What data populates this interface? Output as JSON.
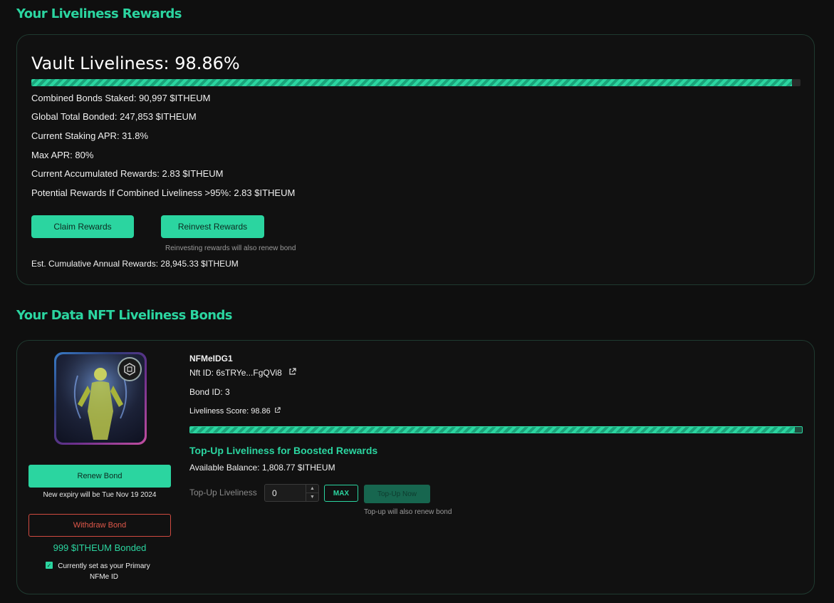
{
  "rewards_section": {
    "title": "Your Liveliness Rewards",
    "vault_liveliness": "Vault Liveliness: 98.86%",
    "vault_liveliness_fraction": 0.9886,
    "stats": [
      "Combined Bonds Staked: 90,997 $ITHEUM",
      "Global Total Bonded: 247,853 $ITHEUM",
      "Current Staking APR: 31.8%",
      "Max APR: 80%",
      "Current Accumulated Rewards: 2.83 $ITHEUM",
      "Potential Rewards If Combined Liveliness >95%: 2.83 $ITHEUM"
    ],
    "claim_label": "Claim Rewards",
    "reinvest_label": "Reinvest Rewards",
    "reinvest_note": "Reinvesting rewards will also renew bond",
    "est_annual": "Est. Cumulative Annual Rewards: 28,945.33 $ITHEUM"
  },
  "bonds_section": {
    "title": "Your Data NFT Liveliness Bonds",
    "nft": {
      "name": "NFMeIDG1",
      "nft_id": "Nft ID: 6sTRYe...FgQVi8",
      "bond_id": "Bond ID: 3",
      "liveliness_score": "Liveliness Score: 98.86",
      "liveliness_fraction": 0.9886
    },
    "renew_label": "Renew Bond",
    "renew_note": "New expiry will be Tue Nov 19 2024",
    "withdraw_label": "Withdraw Bond",
    "bonded_amount": "999 $ITHEUM Bonded",
    "primary_note": "Currently set as your Primary NFMe ID",
    "boost_title": "Top-Up Liveliness for Boosted Rewards",
    "available_balance": "Available Balance: 1,808.77 $ITHEUM",
    "topup_label": "Top-Up Liveliness",
    "topup_value": "0",
    "max_label": "MAX",
    "topup_button": "Top-Up Now",
    "topup_note": "Top-up will also renew bond"
  },
  "colors": {
    "accent": "#2bd5a0",
    "danger": "#d04a40",
    "background": "#0f0f0f"
  },
  "icons": [
    "external-link-icon",
    "chevron-up-icon",
    "chevron-down-icon",
    "check-icon",
    "nft-badge-icon"
  ]
}
